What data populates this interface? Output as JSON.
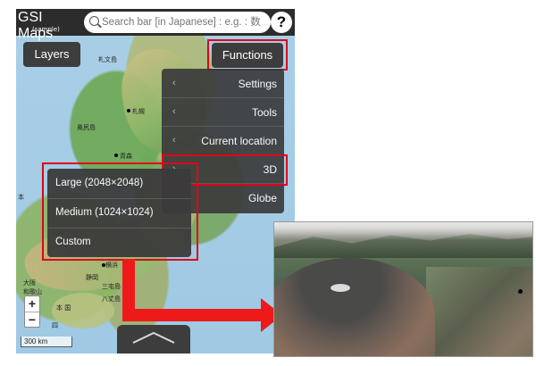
{
  "header": {
    "logo_title": "GSI Maps",
    "logo_sub": "(sample)",
    "search_placeholder": "Search bar [in Japanese] : e.g. : 数",
    "help_label": "?"
  },
  "buttons": {
    "layers": "Layers",
    "functions": "Functions"
  },
  "functions_menu": {
    "items": [
      {
        "label": "Settings",
        "chevron": "‹"
      },
      {
        "label": "Tools",
        "chevron": "‹"
      },
      {
        "label": "Current location",
        "chevron": "‹"
      },
      {
        "label": "3D",
        "chevron": "›"
      },
      {
        "label": "Globe",
        "chevron": ""
      }
    ]
  },
  "size_menu": {
    "items": [
      {
        "label": "Large (2048×2048)"
      },
      {
        "label": "Medium (1024×1024)"
      },
      {
        "label": "Custom"
      }
    ]
  },
  "zoom": {
    "in": "+",
    "out": "−"
  },
  "scale_label": "300 km",
  "map_labels": [
    {
      "text": "札文島"
    },
    {
      "text": "札幌"
    },
    {
      "text": "奥尻島"
    },
    {
      "text": "青森"
    },
    {
      "text": "本"
    },
    {
      "text": "静岡"
    },
    {
      "text": "横浜"
    },
    {
      "text": "八丈島"
    },
    {
      "text": "大阪"
    },
    {
      "text": "和歌山"
    },
    {
      "text": "本 国"
    },
    {
      "text": "四"
    },
    {
      "text": "三宅島"
    }
  ],
  "colors": {
    "header_bg": "#2c2c2c",
    "menu_bg": "#3b3b3b",
    "highlight_red": "#e0001b",
    "arrow_red": "#ee1a1a"
  }
}
